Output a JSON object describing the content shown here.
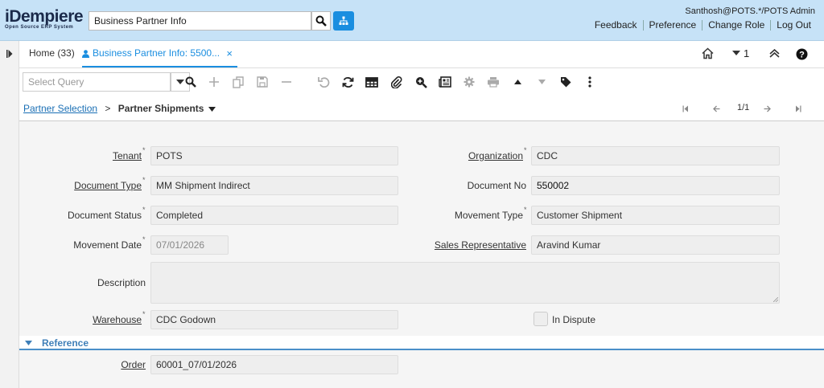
{
  "header": {
    "logo_main": "iDempiere",
    "logo_sub": "Open Source ERP System",
    "search_value": "Business Partner Info",
    "user": "Santhosh@POTS.*/POTS Admin",
    "links": [
      "Feedback",
      "Preference",
      "Change Role",
      "Log Out"
    ]
  },
  "tabs": {
    "home": "Home (33)",
    "active": "Business Partner Info: 5500...",
    "close": "×",
    "window_count": "1"
  },
  "toolbar": {
    "query_placeholder": "Select Query"
  },
  "breadcrumb": {
    "parent": "Partner Selection",
    "separator": ">",
    "current": "Partner Shipments",
    "record_nav": "1/1"
  },
  "form": {
    "tenant_label": "Tenant",
    "tenant": "POTS",
    "organization_label": "Organization",
    "organization": "CDC",
    "doctype_label": "Document Type",
    "doctype": "MM Shipment Indirect",
    "docno_label": "Document No",
    "docno": "550002",
    "docstatus_label": "Document Status",
    "docstatus": "Completed",
    "movetype_label": "Movement Type",
    "movetype": "Customer Shipment",
    "movedate_label": "Movement Date",
    "movedate": "07/01/2026",
    "salesrep_label": "Sales Representative",
    "salesrep": "Aravind Kumar",
    "description_label": "Description",
    "description": "",
    "warehouse_label": "Warehouse",
    "warehouse": "CDC Godown",
    "indispute_label": "In Dispute",
    "reference_section": "Reference",
    "order_label": "Order",
    "order": "60001_07/01/2026"
  },
  "colors": {
    "accent": "#1a8ee0",
    "header_bg": "#c6e2f7",
    "section": "#3f7fb8"
  }
}
